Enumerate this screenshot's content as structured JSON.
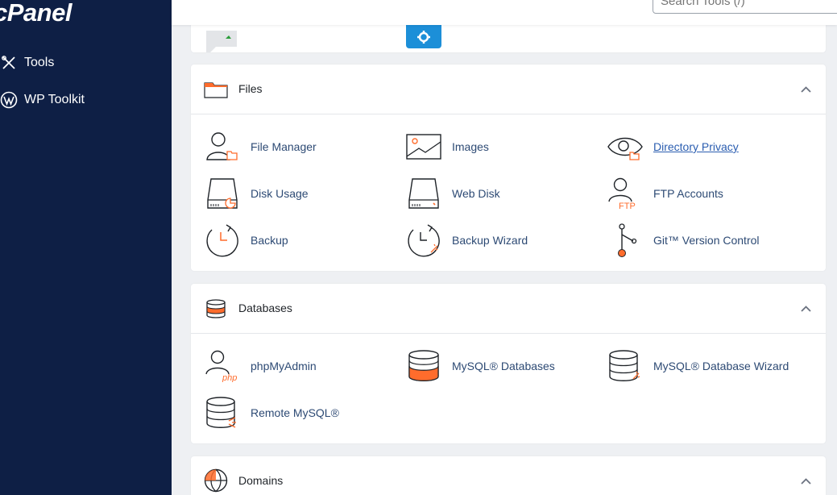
{
  "brand": {
    "logo_text": "cPanel"
  },
  "sidebar": {
    "items": [
      {
        "label": "Tools",
        "icon": "tools-icon"
      },
      {
        "label": "WP Toolkit",
        "icon": "wordpress-icon"
      }
    ]
  },
  "search": {
    "placeholder": "Search Tools (/)"
  },
  "colors": {
    "sidebar_bg": "#0e1f45",
    "accent_orange": "#ff6c2c",
    "link_blue": "#2d4a74",
    "partial_blue": "#1c8fd8",
    "partial_green": "#2a9d3a"
  },
  "sections": {
    "files": {
      "title": "Files",
      "items": [
        {
          "label": "File Manager",
          "icon": "file-manager-icon"
        },
        {
          "label": "Images",
          "icon": "images-icon"
        },
        {
          "label": "Directory Privacy",
          "icon": "directory-privacy-icon"
        },
        {
          "label": "Disk Usage",
          "icon": "disk-usage-icon"
        },
        {
          "label": "Web Disk",
          "icon": "web-disk-icon"
        },
        {
          "label": "FTP Accounts",
          "icon": "ftp-accounts-icon",
          "badge": "FTP"
        },
        {
          "label": "Backup",
          "icon": "backup-icon"
        },
        {
          "label": "Backup Wizard",
          "icon": "backup-wizard-icon"
        },
        {
          "label": "Git™ Version Control",
          "icon": "git-icon"
        }
      ]
    },
    "databases": {
      "title": "Databases",
      "items": [
        {
          "label": "phpMyAdmin",
          "icon": "phpmyadmin-icon",
          "badge": "php"
        },
        {
          "label": "MySQL® Databases",
          "icon": "mysql-databases-icon"
        },
        {
          "label": "MySQL® Database Wizard",
          "icon": "mysql-wizard-icon"
        },
        {
          "label": "Remote MySQL®",
          "icon": "remote-mysql-icon"
        }
      ]
    },
    "domains": {
      "title": "Domains"
    }
  }
}
